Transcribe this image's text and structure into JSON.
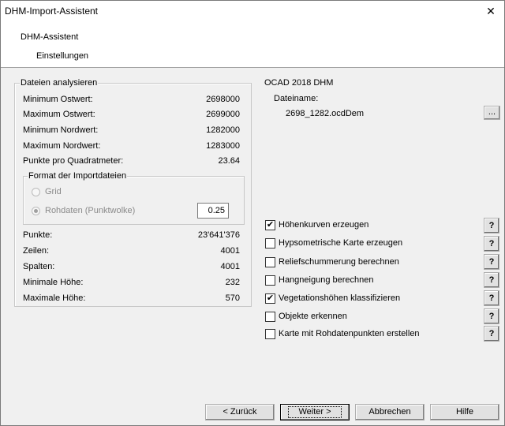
{
  "window": {
    "title": "DHM-Import-Assistent",
    "close_glyph": "✕"
  },
  "header": {
    "title": "DHM-Assistent",
    "subtitle": "Einstellungen"
  },
  "analysis": {
    "legend": "Dateien analysieren",
    "rows": [
      {
        "label": "Minimum Ostwert:",
        "value": "2698000"
      },
      {
        "label": "Maximum Ostwert:",
        "value": "2699000"
      },
      {
        "label": "Minimum Nordwert:",
        "value": "1282000"
      },
      {
        "label": "Maximum Nordwert:",
        "value": "1283000"
      },
      {
        "label": "Punkte pro Quadratmeter:",
        "value": "23.64"
      }
    ],
    "format": {
      "legend": "Format der Importdateien",
      "grid_label": "Grid",
      "rohdaten_label": "Rohdaten (Punktwolke)",
      "rohdaten_value": "0.25"
    },
    "stats": [
      {
        "label": "Punkte:",
        "value": "23'641'376"
      },
      {
        "label": "Zeilen:",
        "value": "4001"
      },
      {
        "label": "Spalten:",
        "value": "4001"
      },
      {
        "label": "Minimale Höhe:",
        "value": "232"
      },
      {
        "label": "Maximale Höhe:",
        "value": "570"
      }
    ]
  },
  "ocad": {
    "title": "OCAD 2018 DHM",
    "filename_label": "Dateiname:",
    "filename": "2698_1282.ocdDem",
    "browse_label": "..."
  },
  "options": [
    {
      "label": "Höhenkurven erzeugen",
      "checked": true
    },
    {
      "label": "Hypsometrische Karte erzeugen",
      "checked": false
    },
    {
      "label": "Reliefschummerung berechnen",
      "checked": false
    },
    {
      "label": "Hangneigung berechnen",
      "checked": false
    },
    {
      "label": "Vegetationshöhen klassifizieren",
      "checked": true
    },
    {
      "label": "Objekte erkennen",
      "checked": false
    },
    {
      "label": "Karte mit Rohdatenpunkten erstellen",
      "checked": false
    }
  ],
  "help_label": "?",
  "checkmark": "✔",
  "buttons": {
    "back": "< Zurück",
    "next": "Weiter >",
    "cancel": "Abbrechen",
    "help": "Hilfe"
  }
}
